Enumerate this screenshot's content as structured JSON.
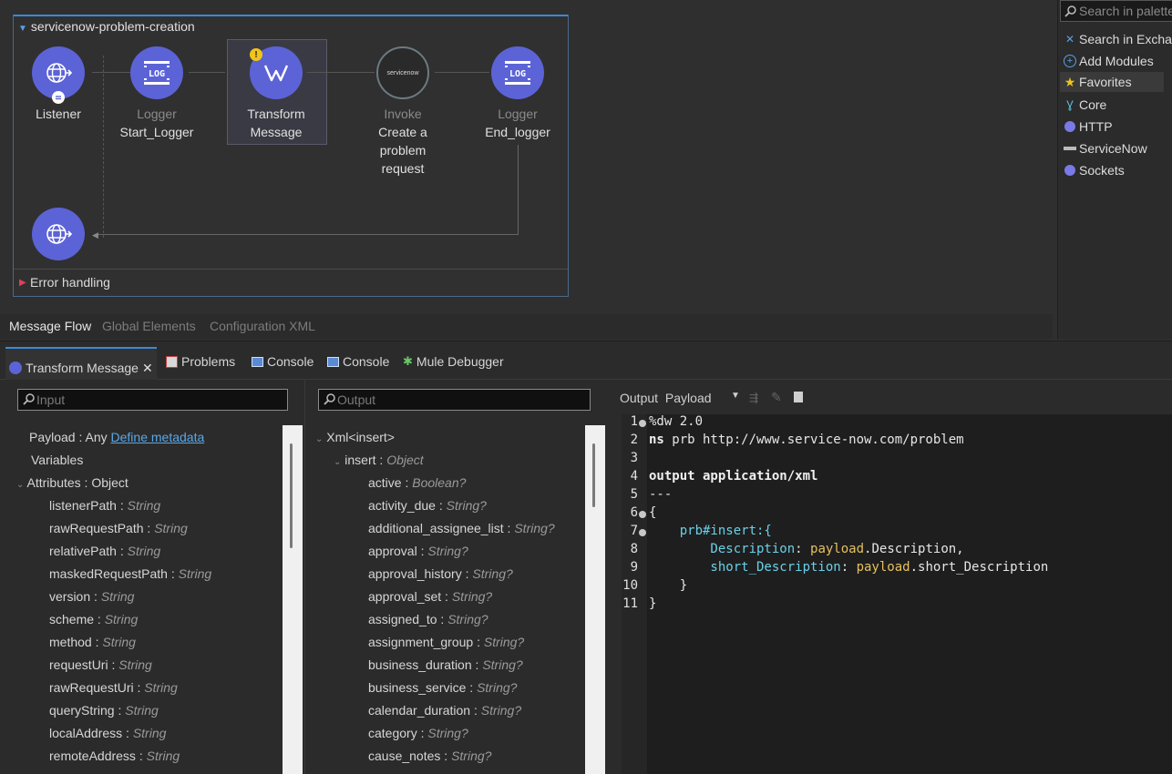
{
  "flow": {
    "title": "servicenow-problem-creation",
    "error_handling": "Error handling",
    "nodes": [
      {
        "type": "",
        "name": "Listener"
      },
      {
        "type": "Logger",
        "name": "Start_Logger"
      },
      {
        "type": "",
        "name": "Transform Message"
      },
      {
        "type": "Invoke",
        "name": "Create a problem request"
      },
      {
        "type": "Logger",
        "name": "End_logger"
      }
    ],
    "servicenow_logo": "servicenow"
  },
  "editor_tabs": [
    "Message Flow",
    "Global Elements",
    "Configuration XML"
  ],
  "palette": {
    "search_placeholder": "Search in palette",
    "items": [
      "Search in Exchange",
      "Add Modules",
      "Favorites",
      "Core",
      "HTTP",
      "ServiceNow",
      "Sockets"
    ]
  },
  "view_tabs": [
    "Transform Message",
    "Problems",
    "Console",
    "Console",
    "Mule Debugger"
  ],
  "input_panel": {
    "search_placeholder": "Input",
    "payload_label": "Payload : Any",
    "define_metadata": "Define metadata",
    "variables": "Variables",
    "attributes": "Attributes : Object",
    "fields": [
      {
        "name": "listenerPath",
        "type": "String"
      },
      {
        "name": "rawRequestPath",
        "type": "String"
      },
      {
        "name": "relativePath",
        "type": "String"
      },
      {
        "name": "maskedRequestPath",
        "type": "String"
      },
      {
        "name": "version",
        "type": "String"
      },
      {
        "name": "scheme",
        "type": "String"
      },
      {
        "name": "method",
        "type": "String"
      },
      {
        "name": "requestUri",
        "type": "String"
      },
      {
        "name": "rawRequestUri",
        "type": "String"
      },
      {
        "name": "queryString",
        "type": "String"
      },
      {
        "name": "localAddress",
        "type": "String"
      },
      {
        "name": "remoteAddress",
        "type": "String"
      }
    ]
  },
  "output_panel": {
    "search_placeholder": "Output",
    "root": "Xml<insert>",
    "insert_name": "insert",
    "insert_type": "Object",
    "fields": [
      {
        "name": "active",
        "type": "Boolean?"
      },
      {
        "name": "activity_due",
        "type": "String?"
      },
      {
        "name": "additional_assignee_list",
        "type": "String?"
      },
      {
        "name": "approval",
        "type": "String?"
      },
      {
        "name": "approval_history",
        "type": "String?"
      },
      {
        "name": "approval_set",
        "type": "String?"
      },
      {
        "name": "assigned_to",
        "type": "String?"
      },
      {
        "name": "assignment_group",
        "type": "String?"
      },
      {
        "name": "business_duration",
        "type": "String?"
      },
      {
        "name": "business_service",
        "type": "String?"
      },
      {
        "name": "calendar_duration",
        "type": "String?"
      },
      {
        "name": "category",
        "type": "String?"
      },
      {
        "name": "cause_notes",
        "type": "String?"
      }
    ]
  },
  "code_panel": {
    "output_label": "Output",
    "target": "Payload",
    "line_numbers": [
      "1",
      "2",
      "3",
      "4",
      "5",
      "6",
      "7",
      "8",
      "9",
      "10",
      "11"
    ],
    "lines": {
      "l1": "%dw 2.0",
      "l2_kw": "ns",
      "l2_rest": " prb http://www.service-now.com/problem",
      "l4": "output application/xml",
      "l5": "---",
      "l6": "{",
      "l7": "    prb#insert:{",
      "l8_key": "        Description",
      "l8_sep": ": ",
      "l8_val": "payload",
      "l8_rest": ".Description,",
      "l9_key": "        short_Description",
      "l9_sep": ": ",
      "l9_val": "payload",
      "l9_rest": ".short_Description",
      "l10": "    }",
      "l11": "}"
    }
  },
  "colors": {
    "accent": "#3a8bd6",
    "node": "#5c63d6",
    "link": "#5aa7e8"
  }
}
